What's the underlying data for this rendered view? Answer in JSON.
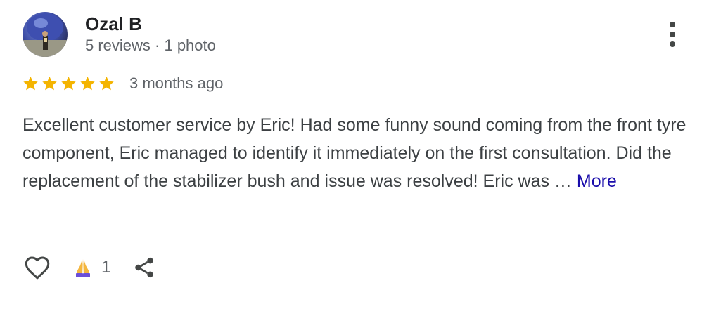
{
  "reviewer": {
    "name": "Ozal B",
    "meta": "5 reviews · 1 photo",
    "avatar_icon": "profile-photo"
  },
  "rating": {
    "stars": 5,
    "max": 5,
    "star_color": "#f4b400",
    "date": "3 months ago"
  },
  "review": {
    "text": "Excellent customer service by Eric! Had some funny sound coming from the front tyre component, Eric managed to identify it immediately on the first consultation. Did the replacement of the stabilizer bush and issue was resolved! Eric was …",
    "more_label": "More",
    "more_color": "#1a0dab"
  },
  "actions": {
    "like_icon": "heart-outline-icon",
    "reaction_icon": "folded-hands-emoji",
    "reaction_count": "1",
    "share_icon": "share-icon"
  },
  "menu_icon": "more-vert-icon"
}
